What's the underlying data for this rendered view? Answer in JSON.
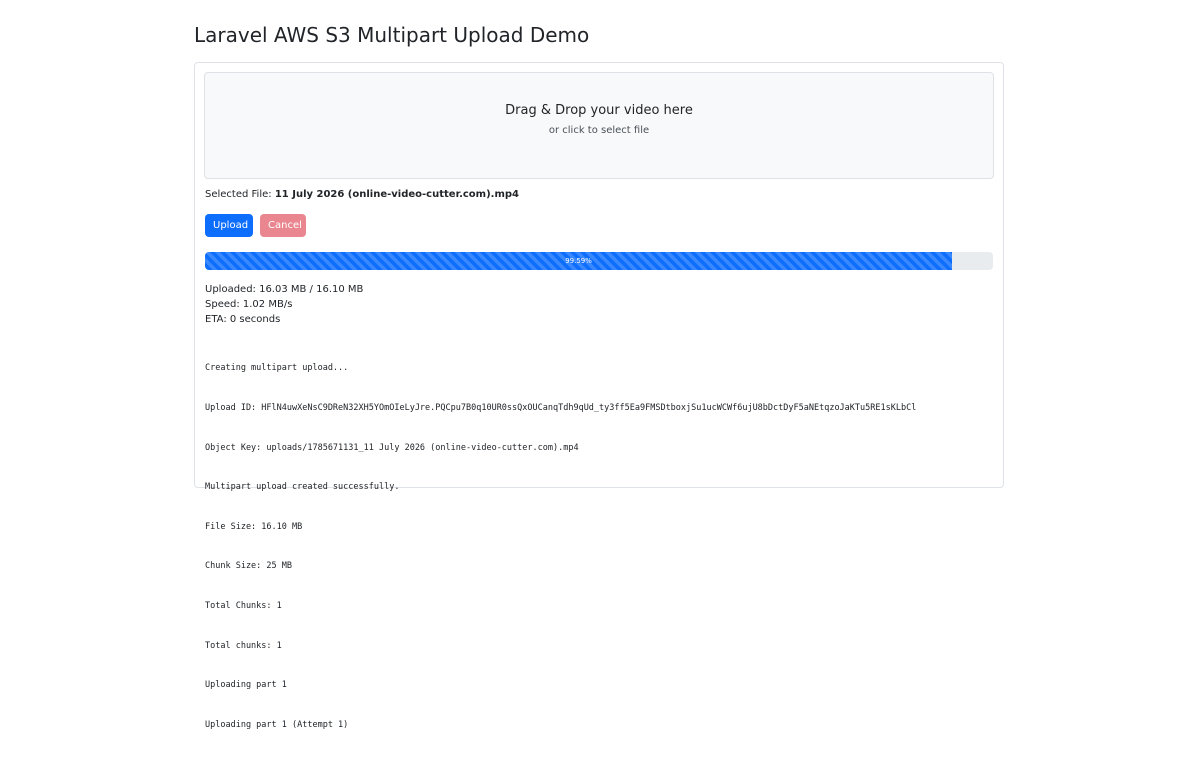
{
  "page": {
    "title": "Laravel AWS S3 Multipart Upload Demo"
  },
  "dropzone": {
    "title": "Drag & Drop your video here",
    "subtitle": "or click to select file"
  },
  "selected_file": {
    "label": "Selected File:",
    "name": "11 July 2026 (online-video-cutter.com).mp4"
  },
  "buttons": {
    "upload": "Upload",
    "cancel": "Cancel"
  },
  "progress": {
    "fraction": 0.9959,
    "label": "99.59%"
  },
  "stats": {
    "uploaded": "Uploaded: 16.03 MB / 16.10 MB",
    "speed": "Speed: 1.02 MB/s",
    "eta": "ETA: 0 seconds"
  },
  "log": [
    "Creating multipart upload...",
    "Upload ID: HFlN4uwXeNsC9DReN32XH5YOmOIeLyJre.PQCpu7B0q10UR0ssQxOUCanqTdh9qUd_ty3ff5Ea9FMSDtboxjSu1ucWCWf6ujU8bDctDyF5aNEtqzoJaKTu5RE1sKLbCl",
    "Object Key: uploads/1785671131_11 July 2026 (online-video-cutter.com).mp4",
    "Multipart upload created successfully.",
    "File Size: 16.10 MB",
    "Chunk Size: 25 MB",
    "Total Chunks: 1",
    "Total chunks: 1",
    "Uploading part 1",
    "Uploading part 1 (Attempt 1)"
  ],
  "colors": {
    "primary": "#0d6efd",
    "danger_disabled": "#ea868f",
    "progress_track": "#e9ecef",
    "dropzone_bg": "#f8f9fa",
    "border": "#dee2e6"
  }
}
